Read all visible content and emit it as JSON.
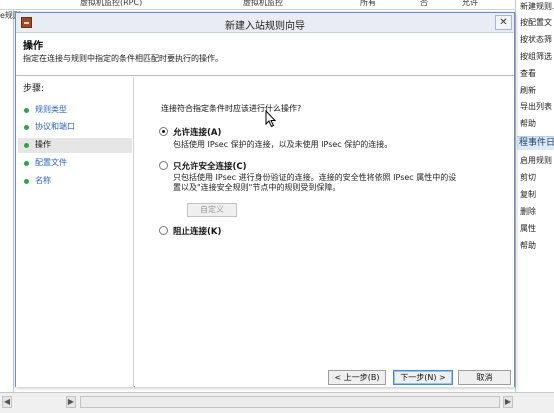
{
  "background": {
    "top_row": {
      "name": "虚拟机监控(RPC)",
      "group": "虚拟机监控",
      "profile": "所有",
      "enabled": "否",
      "action": "允许"
    },
    "left_cut_text": "e规则",
    "actions_pane": {
      "items_top": [
        "新建规则...",
        "按配置文",
        "按状态筛",
        "按组筛选",
        "查看",
        "刷新",
        "导出列表",
        "帮助"
      ],
      "section_header": "程事件日",
      "items_bottom": [
        "启用规则",
        "剪切",
        "复制",
        "删除",
        "属性",
        "帮助"
      ]
    },
    "scroll_left": "◀",
    "scroll_right": "▶"
  },
  "dialog": {
    "title": "新建入站规则向导",
    "close_label": "✕",
    "header_title": "操作",
    "header_desc": "指定在连接与规则中指定的条件相匹配时要执行的操作。",
    "steps_title": "步骤:",
    "steps": [
      "规则类型",
      "协议和端口",
      "操作",
      "配置文件",
      "名称"
    ],
    "active_step": 2,
    "question": "连接符合指定条件时应该进行什么操作?",
    "options": [
      {
        "label": "允许连接(A)",
        "desc": [
          "包括使用 IPsec 保护的连接，以及未使用 IPsec 保护的连接。"
        ],
        "checked": true
      },
      {
        "label": "只允许安全连接(C)",
        "desc": [
          "只包括使用 IPsec 进行身份验证的连接。连接的安全性将依照 IPsec 属性中的设",
          "置以及\"连接安全规则\"节点中的规则受到保障。"
        ],
        "checked": false
      },
      {
        "label": "阻止连接(K)",
        "desc": [],
        "checked": false
      }
    ],
    "customize_label": "自定义",
    "buttons": {
      "back": "< 上一步(B)",
      "next": "下一步(N) >",
      "cancel": "取消"
    }
  }
}
